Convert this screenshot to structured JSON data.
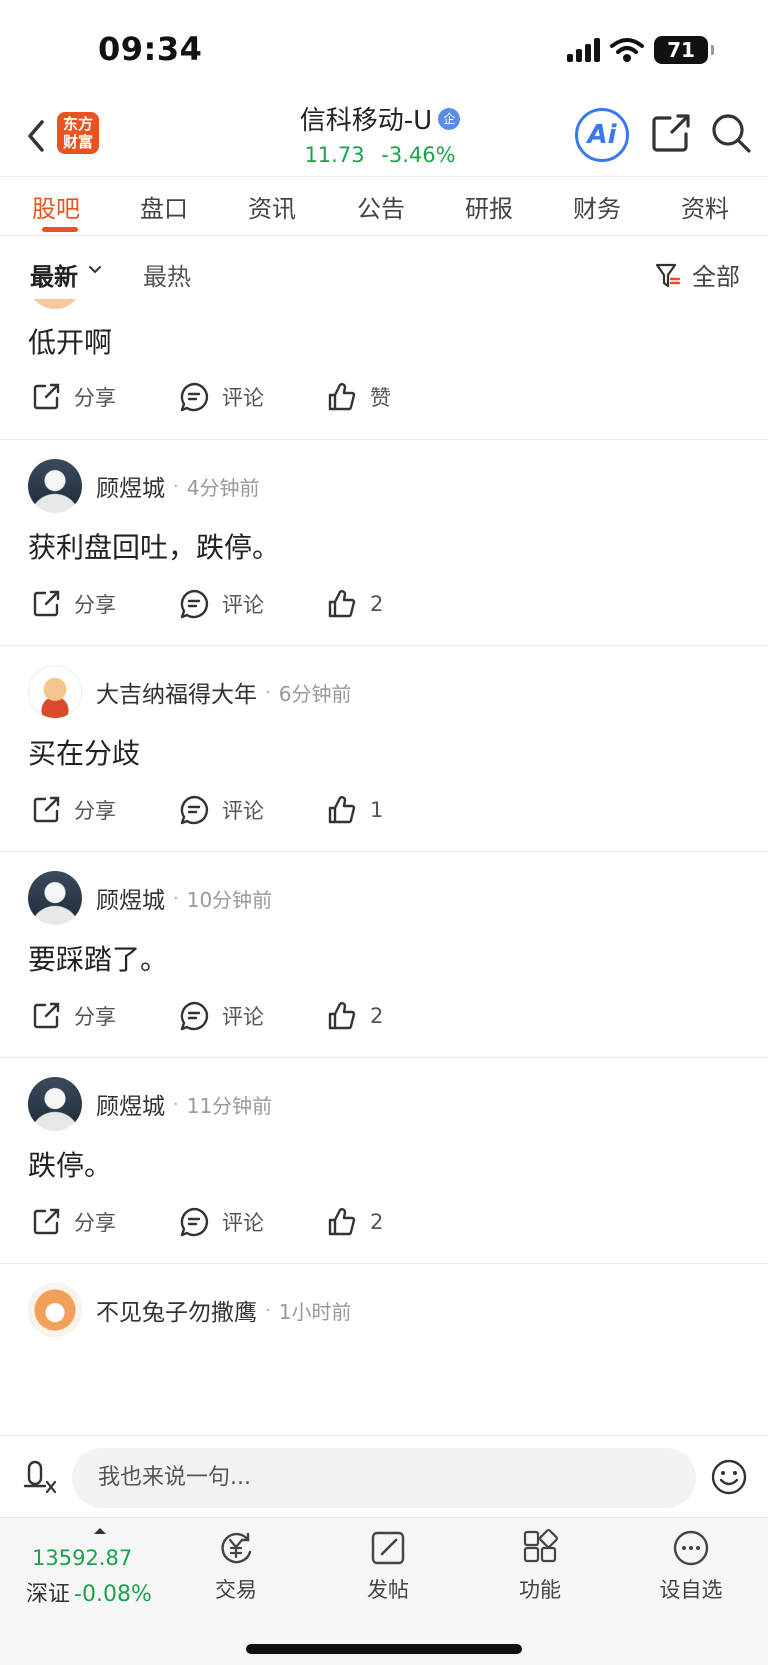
{
  "status_bar": {
    "time": "09:34",
    "battery": "71"
  },
  "header": {
    "logo_line1": "东方",
    "logo_line2": "财富",
    "stock_name": "信科移动-U",
    "badge": "企",
    "price": "11.73",
    "change_pct": "-3.46%",
    "ai_label": "Ai"
  },
  "tabs": [
    "股吧",
    "盘口",
    "资讯",
    "公告",
    "研报",
    "财务",
    "资料"
  ],
  "filter": {
    "latest": "最新",
    "hot": "最热",
    "all": "全部"
  },
  "actions": {
    "share": "分享",
    "comment": "评论",
    "like": "赞"
  },
  "posts": [
    {
      "author": "",
      "time": "",
      "text": "低开啊",
      "likes": "赞"
    },
    {
      "author": "顾煜城",
      "time": "4分钟前",
      "text": "获利盘回吐，跌停。",
      "likes": "2"
    },
    {
      "author": "大吉纳福得大年",
      "time": "6分钟前",
      "text": "买在分歧",
      "likes": "1"
    },
    {
      "author": "顾煜城",
      "time": "10分钟前",
      "text": "要踩踏了。",
      "likes": "2"
    },
    {
      "author": "顾煜城",
      "time": "11分钟前",
      "text": "跌停。",
      "likes": "2"
    },
    {
      "author": "不见兔子勿撒鹰",
      "time": "1小时前",
      "text": "",
      "likes": ""
    }
  ],
  "comment_bar": {
    "placeholder": "我也来说一句..."
  },
  "bottom_nav": {
    "index_value": "13592.87",
    "index_name": "深证",
    "index_change": "-0.08%",
    "items": [
      "交易",
      "发帖",
      "功能",
      "设自选"
    ]
  },
  "colors": {
    "accent": "#e8531f",
    "down_green": "#1aa34a",
    "ai_blue": "#3a78ef"
  }
}
